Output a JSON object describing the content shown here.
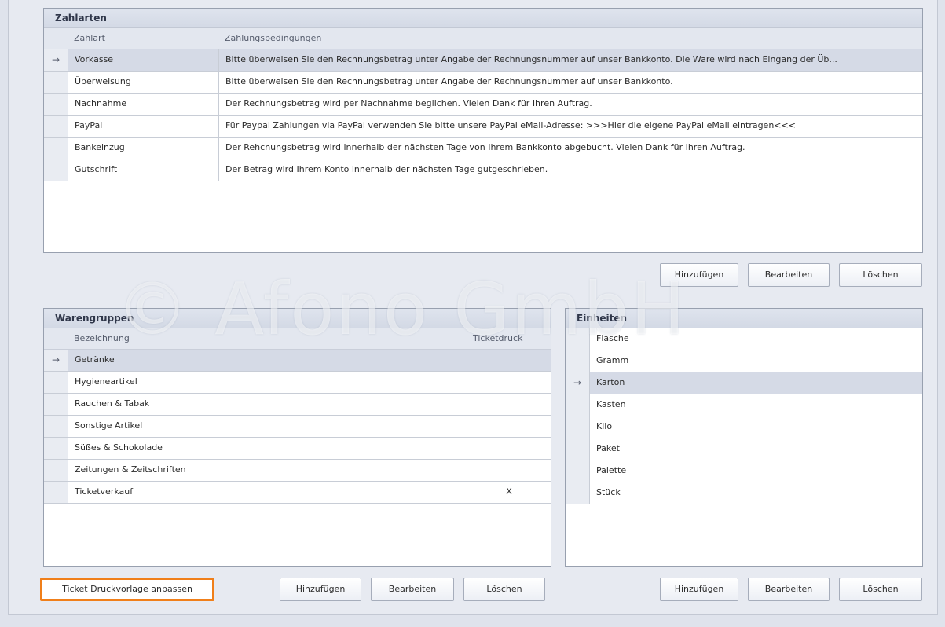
{
  "zahlarten": {
    "title": "Zahlarten",
    "columns": [
      "Zahlart",
      "Zahlungsbedingungen"
    ],
    "rows": [
      {
        "name": "Vorkasse",
        "terms": "Bitte überweisen Sie den Rechnungsbetrag unter Angabe der Rechnungsnummer auf unser Bankkonto. Die Ware wird nach Eingang der Üb..."
      },
      {
        "name": "Überweisung",
        "terms": "Bitte überweisen Sie den Rechnungsbetrag unter Angabe der Rechnungsnummer auf unser Bankkonto."
      },
      {
        "name": "Nachnahme",
        "terms": "Der Rechnungsbetrag wird per Nachnahme beglichen. Vielen Dank für Ihren Auftrag."
      },
      {
        "name": "PayPal",
        "terms": "Für Paypal Zahlungen via PayPal verwenden Sie bitte unsere PayPal eMail-Adresse: >>>Hier die eigene PayPal eMail eintragen<<<"
      },
      {
        "name": "Bankeinzug",
        "terms": "Der Rehcnungsbetrag wird innerhalb der nächsten Tage von Ihrem Bankkonto abgebucht. Vielen Dank für Ihren Auftrag."
      },
      {
        "name": "Gutschrift",
        "terms": "Der Betrag wird Ihrem Konto innerhalb der nächsten Tage gutgeschrieben."
      }
    ],
    "selected_index": 0,
    "buttons": {
      "add": "Hinzufügen",
      "edit": "Bearbeiten",
      "delete": "Löschen"
    }
  },
  "warengruppen": {
    "title": "Warengruppen",
    "columns": [
      "Bezeichnung",
      "Ticketdruck"
    ],
    "rows": [
      {
        "name": "Getränke",
        "ticket": ""
      },
      {
        "name": "Hygieneartikel",
        "ticket": ""
      },
      {
        "name": "Rauchen & Tabak",
        "ticket": ""
      },
      {
        "name": "Sonstige Artikel",
        "ticket": ""
      },
      {
        "name": "Süßes & Schokolade",
        "ticket": ""
      },
      {
        "name": "Zeitungen & Zeitschriften",
        "ticket": ""
      },
      {
        "name": "Ticketverkauf",
        "ticket": "X"
      }
    ],
    "selected_index": 0,
    "ticket_button": "Ticket Druckvorlage anpassen",
    "buttons": {
      "add": "Hinzufügen",
      "edit": "Bearbeiten",
      "delete": "Löschen"
    }
  },
  "einheiten": {
    "title": "Einheiten",
    "rows": [
      "Flasche",
      "Gramm",
      "Karton",
      "Kasten",
      "Kilo",
      "Paket",
      "Palette",
      "Stück"
    ],
    "selected_index": 2,
    "buttons": {
      "add": "Hinzufügen",
      "edit": "Bearbeiten",
      "delete": "Löschen"
    }
  },
  "watermark": "© Afono GmbH",
  "icons": {
    "row_indicator": "arrow-right-icon"
  },
  "colors": {
    "selected_row": "#d5dae6",
    "highlight_border": "#f07f1a"
  }
}
